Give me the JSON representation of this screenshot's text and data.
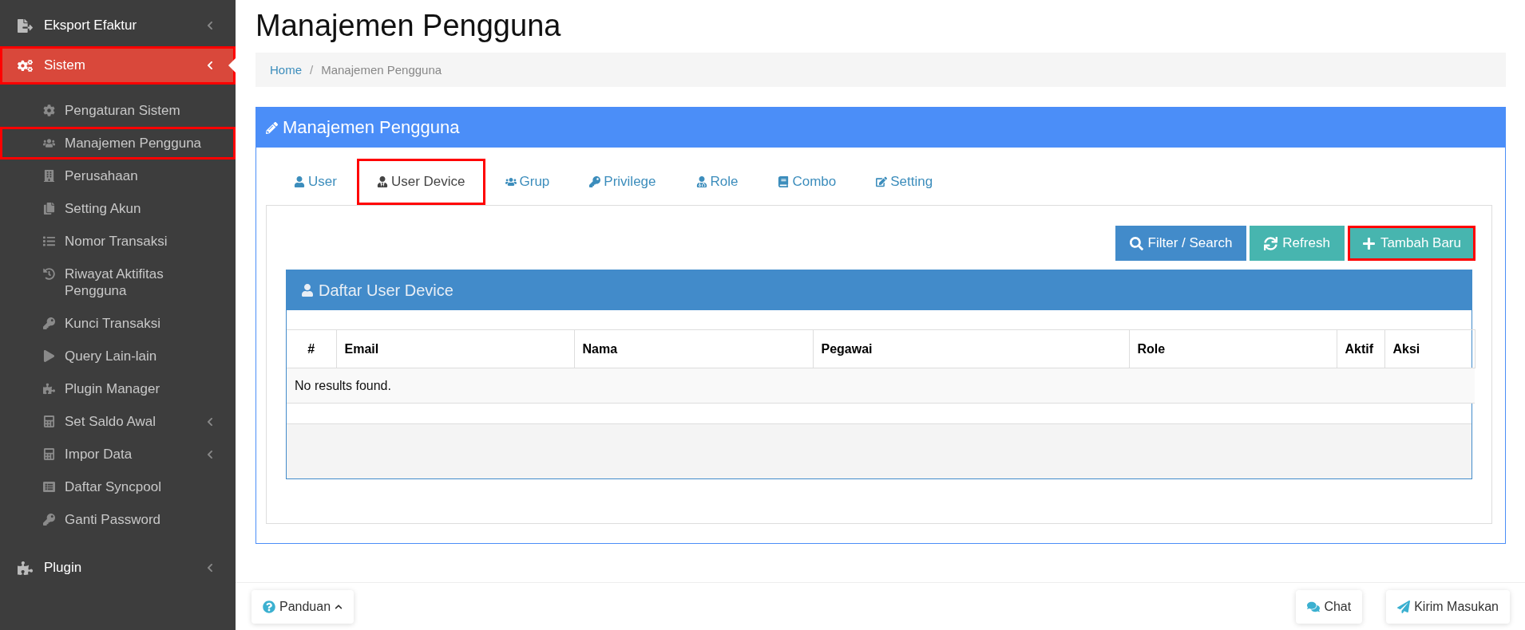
{
  "sidebar": {
    "items": [
      {
        "label": "Eksport Efaktur",
        "selected": false,
        "highlighted": false
      },
      {
        "label": "Sistem",
        "selected": true,
        "highlighted": true,
        "children": [
          {
            "label": "Pengaturan Sistem",
            "highlighted": false,
            "submenu": false
          },
          {
            "label": "Manajemen Pengguna",
            "highlighted": true,
            "submenu": false
          },
          {
            "label": "Perusahaan",
            "highlighted": false,
            "submenu": false
          },
          {
            "label": "Setting Akun",
            "highlighted": false,
            "submenu": false
          },
          {
            "label": "Nomor Transaksi",
            "highlighted": false,
            "submenu": false
          },
          {
            "label": "Riwayat Aktifitas Pengguna",
            "highlighted": false,
            "submenu": false
          },
          {
            "label": "Kunci Transaksi",
            "highlighted": false,
            "submenu": false
          },
          {
            "label": "Query Lain-lain",
            "highlighted": false,
            "submenu": false
          },
          {
            "label": "Plugin Manager",
            "highlighted": false,
            "submenu": false
          },
          {
            "label": "Set Saldo Awal",
            "highlighted": false,
            "submenu": true
          },
          {
            "label": "Impor Data",
            "highlighted": false,
            "submenu": true
          },
          {
            "label": "Daftar Syncpool",
            "highlighted": false,
            "submenu": false
          },
          {
            "label": "Ganti Password",
            "highlighted": false,
            "submenu": false
          }
        ]
      },
      {
        "label": "Plugin",
        "selected": false,
        "highlighted": false
      }
    ]
  },
  "page": {
    "title": "Manajemen Pengguna",
    "breadcrumb_separator": "/",
    "breadcrumb": [
      {
        "label": "Home",
        "link": true
      },
      {
        "label": "Manajemen Pengguna",
        "link": false
      }
    ]
  },
  "panel": {
    "title": "Manajemen Pengguna",
    "tabs": [
      {
        "label": "User",
        "selected": false,
        "highlighted": false
      },
      {
        "label": "User Device",
        "selected": true,
        "highlighted": true
      },
      {
        "label": "Grup",
        "selected": false,
        "highlighted": false
      },
      {
        "label": "Privilege",
        "selected": false,
        "highlighted": false
      },
      {
        "label": "Role",
        "selected": false,
        "highlighted": false
      },
      {
        "label": "Combo",
        "selected": false,
        "highlighted": false
      },
      {
        "label": "Setting",
        "selected": false,
        "highlighted": false
      }
    ],
    "buttons": [
      {
        "label": "Filter / Search",
        "kind": "primary",
        "highlighted": false
      },
      {
        "label": "Refresh",
        "kind": "teal",
        "highlighted": false
      },
      {
        "label": "Tambah Baru",
        "kind": "teal",
        "highlighted": true
      }
    ],
    "table": {
      "title": "Daftar User Device",
      "columns": [
        "#",
        "Email",
        "Nama",
        "Pegawai",
        "Role",
        "Aktif",
        "Aksi"
      ],
      "empty_message": "No results found."
    }
  },
  "footer": {
    "left": [
      {
        "label": "Panduan"
      }
    ],
    "right": [
      {
        "label": "Chat"
      },
      {
        "label": "Kirim Masukan"
      }
    ]
  }
}
